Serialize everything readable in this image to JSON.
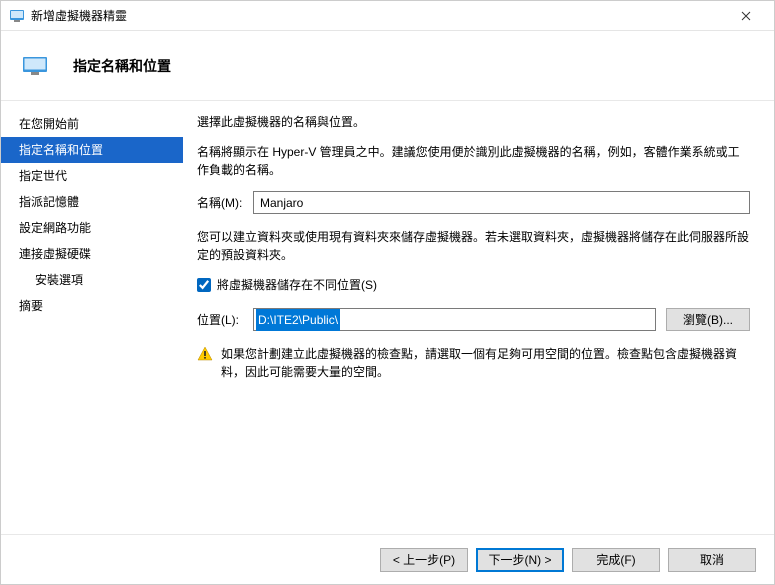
{
  "window": {
    "title": "新增虛擬機器精靈"
  },
  "header": {
    "title": "指定名稱和位置"
  },
  "sidebar": {
    "items": [
      {
        "label": "在您開始前",
        "selected": false,
        "indent": false
      },
      {
        "label": "指定名稱和位置",
        "selected": true,
        "indent": false
      },
      {
        "label": "指定世代",
        "selected": false,
        "indent": false
      },
      {
        "label": "指派記憶體",
        "selected": false,
        "indent": false
      },
      {
        "label": "設定網路功能",
        "selected": false,
        "indent": false
      },
      {
        "label": "連接虛擬硬碟",
        "selected": false,
        "indent": false
      },
      {
        "label": "安裝選項",
        "selected": false,
        "indent": true
      },
      {
        "label": "摘要",
        "selected": false,
        "indent": false
      }
    ]
  },
  "content": {
    "intro": "選擇此虛擬機器的名稱與位置。",
    "name_help": "名稱將顯示在 Hyper-V 管理員之中。建議您使用便於識別此虛擬機器的名稱，例如，客體作業系統或工作負載的名稱。",
    "name_label": "名稱(M):",
    "name_value": "Manjaro",
    "loc_help": "您可以建立資料夾或使用現有資料夾來儲存虛擬機器。若未選取資料夾，虛擬機器將儲存在此伺服器所設定的預設資料夾。",
    "store_diff_checked": true,
    "store_diff_label": "將虛擬機器儲存在不同位置(S)",
    "loc_label": "位置(L):",
    "loc_value": "D:\\ITE2\\Public\\",
    "browse_label": "瀏覽(B)...",
    "warning": "如果您計劃建立此虛擬機器的檢查點，請選取一個有足夠可用空間的位置。檢查點包含虛擬機器資料，因此可能需要大量的空間。"
  },
  "footer": {
    "prev": "< 上一步(P)",
    "next": "下一步(N) >",
    "finish": "完成(F)",
    "cancel": "取消"
  }
}
